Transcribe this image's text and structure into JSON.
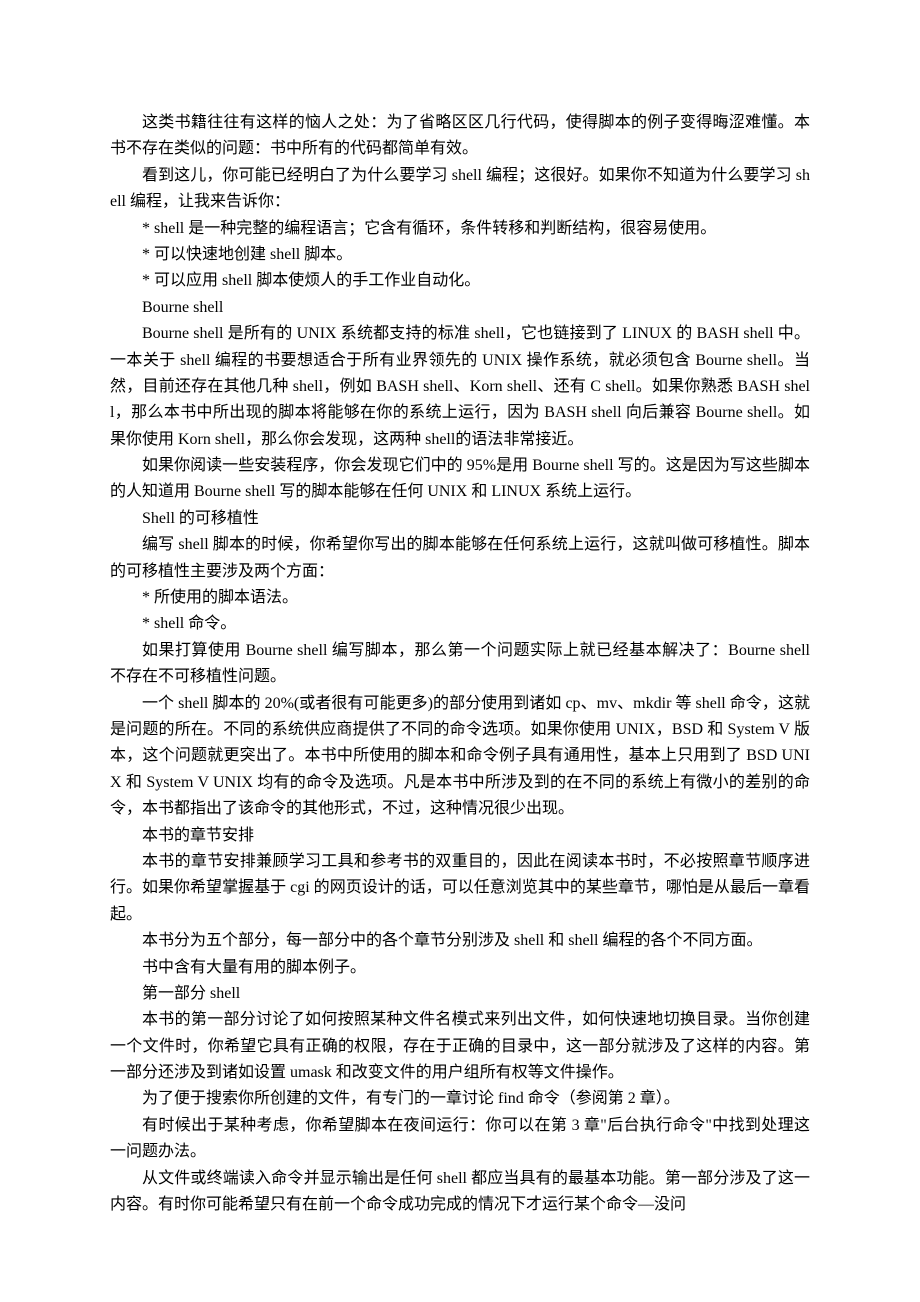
{
  "paragraphs": [
    "这类书籍往往有这样的恼人之处：为了省略区区几行代码，使得脚本的例子变得晦涩难懂。本书不存在类似的问题：书中所有的代码都简单有效。",
    "看到这儿，你可能已经明白了为什么要学习 shell 编程；这很好。如果你不知道为什么要学习 shell 编程，让我来告诉你：",
    "* shell 是一种完整的编程语言；它含有循环，条件转移和判断结构，很容易使用。",
    "* 可以快速地创建 shell 脚本。",
    "* 可以应用 shell 脚本使烦人的手工作业自动化。",
    "Bourne shell",
    "Bourne shell 是所有的 UNIX 系统都支持的标准 shell，它也链接到了 LINUX 的 BASH shell 中。一本关于 shell 编程的书要想适合于所有业界领先的 UNIX 操作系统，就必须包含 Bourne shell。当然，目前还存在其他几种 shell，例如 BASH shell、Korn shell、还有 C shell。如果你熟悉 BASH shell，那么本书中所出现的脚本将能够在你的系统上运行，因为 BASH shell 向后兼容 Bourne shell。如果你使用 Korn shell，那么你会发现，这两种 shell的语法非常接近。",
    "如果你阅读一些安装程序，你会发现它们中的 95%是用 Bourne shell 写的。这是因为写这些脚本的人知道用 Bourne shell 写的脚本能够在任何 UNIX 和 LINUX 系统上运行。",
    "Shell 的可移植性",
    "编写 shell 脚本的时候，你希望你写出的脚本能够在任何系统上运行，这就叫做可移植性。脚本的可移植性主要涉及两个方面：",
    "* 所使用的脚本语法。",
    "* shell 命令。",
    "如果打算使用 Bourne shell 编写脚本，那么第一个问题实际上就已经基本解决了：Bourne shell 不存在不可移植性问题。",
    "一个 shell 脚本的 20%(或者很有可能更多)的部分使用到诸如 cp、mv、mkdir 等 shell 命令，这就是问题的所在。不同的系统供应商提供了不同的命令选项。如果你使用 UNIX，BSD 和 System V 版本，这个问题就更突出了。本书中所使用的脚本和命令例子具有通用性，基本上只用到了 BSD UNIX 和 System V UNIX 均有的命令及选项。凡是本书中所涉及到的在不同的系统上有微小的差别的命令，本书都指出了该命令的其他形式，不过，这种情况很少出现。",
    "本书的章节安排",
    "本书的章节安排兼顾学习工具和参考书的双重目的，因此在阅读本书时，不必按照章节顺序进行。如果你希望掌握基于 cgi 的网页设计的话，可以任意浏览其中的某些章节，哪怕是从最后一章看起。",
    "本书分为五个部分，每一部分中的各个章节分别涉及 shell 和 shell 编程的各个不同方面。",
    "书中含有大量有用的脚本例子。",
    "第一部分    shell",
    "本书的第一部分讨论了如何按照某种文件名模式来列出文件，如何快速地切换目录。当你创建一个文件时，你希望它具有正确的权限，存在于正确的目录中，这一部分就涉及了这样的内容。第一部分还涉及到诸如设置 umask 和改变文件的用户组所有权等文件操作。",
    "为了便于搜索你所创建的文件，有专门的一章讨论 find 命令（参阅第 2 章）。",
    "有时候出于某种考虑，你希望脚本在夜间运行：你可以在第 3 章\"后台执行命令\"中找到处理这一问题办法。",
    "从文件或终端读入命令并显示输出是任何 shell 都应当具有的最基本功能。第一部分涉及了这一内容。有时你可能希望只有在前一个命令成功完成的情况下才运行某个命令—没问"
  ]
}
